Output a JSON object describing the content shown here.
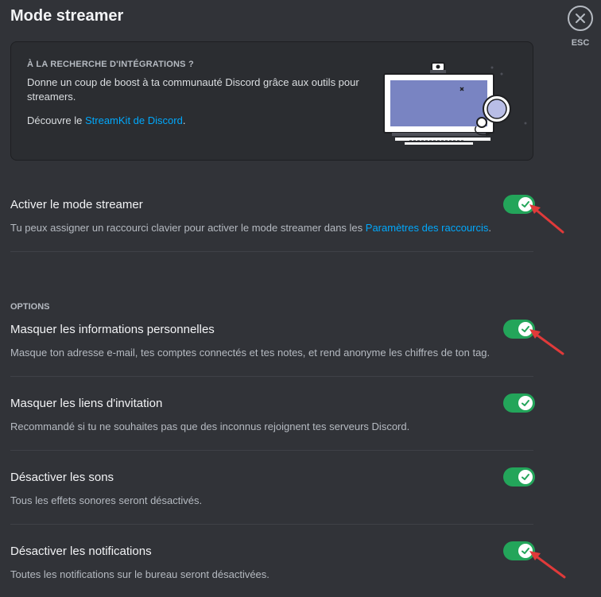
{
  "page": {
    "title": "Mode streamer"
  },
  "close": {
    "esc_label": "ESC"
  },
  "promo": {
    "heading": "À LA RECHERCHE D'INTÉGRATIONS ?",
    "text": "Donne un coup de boost à ta communauté Discord grâce aux outils pour streamers.",
    "link_prefix": "Découvre le ",
    "link_text": "StreamKit de Discord",
    "link_suffix": "."
  },
  "streamer_mode": {
    "title": "Activer le mode streamer",
    "desc_prefix": "Tu peux assigner un raccourci clavier pour activer le mode streamer dans les ",
    "desc_link": "Paramètres des raccourcis",
    "desc_suffix": ".",
    "enabled": true
  },
  "options": {
    "label": "OPTIONS",
    "items": [
      {
        "title": "Masquer les informations personnelles",
        "desc": "Masque ton adresse e-mail, tes comptes connectés et tes notes, et rend anonyme les chiffres de ton tag.",
        "enabled": true
      },
      {
        "title": "Masquer les liens d'invitation",
        "desc": "Recommandé si tu ne souhaites pas que des inconnus rejoignent tes serveurs Discord.",
        "enabled": true
      },
      {
        "title": "Désactiver les sons",
        "desc": "Tous les effets sonores seront désactivés.",
        "enabled": true
      },
      {
        "title": "Désactiver les notifications",
        "desc": "Toutes les notifications sur le bureau seront désactivées.",
        "enabled": true
      }
    ]
  },
  "colors": {
    "background": "#313338",
    "toggle_on": "#23a55a",
    "link": "#00a8fc",
    "annotation_arrow": "#e03a3a"
  }
}
